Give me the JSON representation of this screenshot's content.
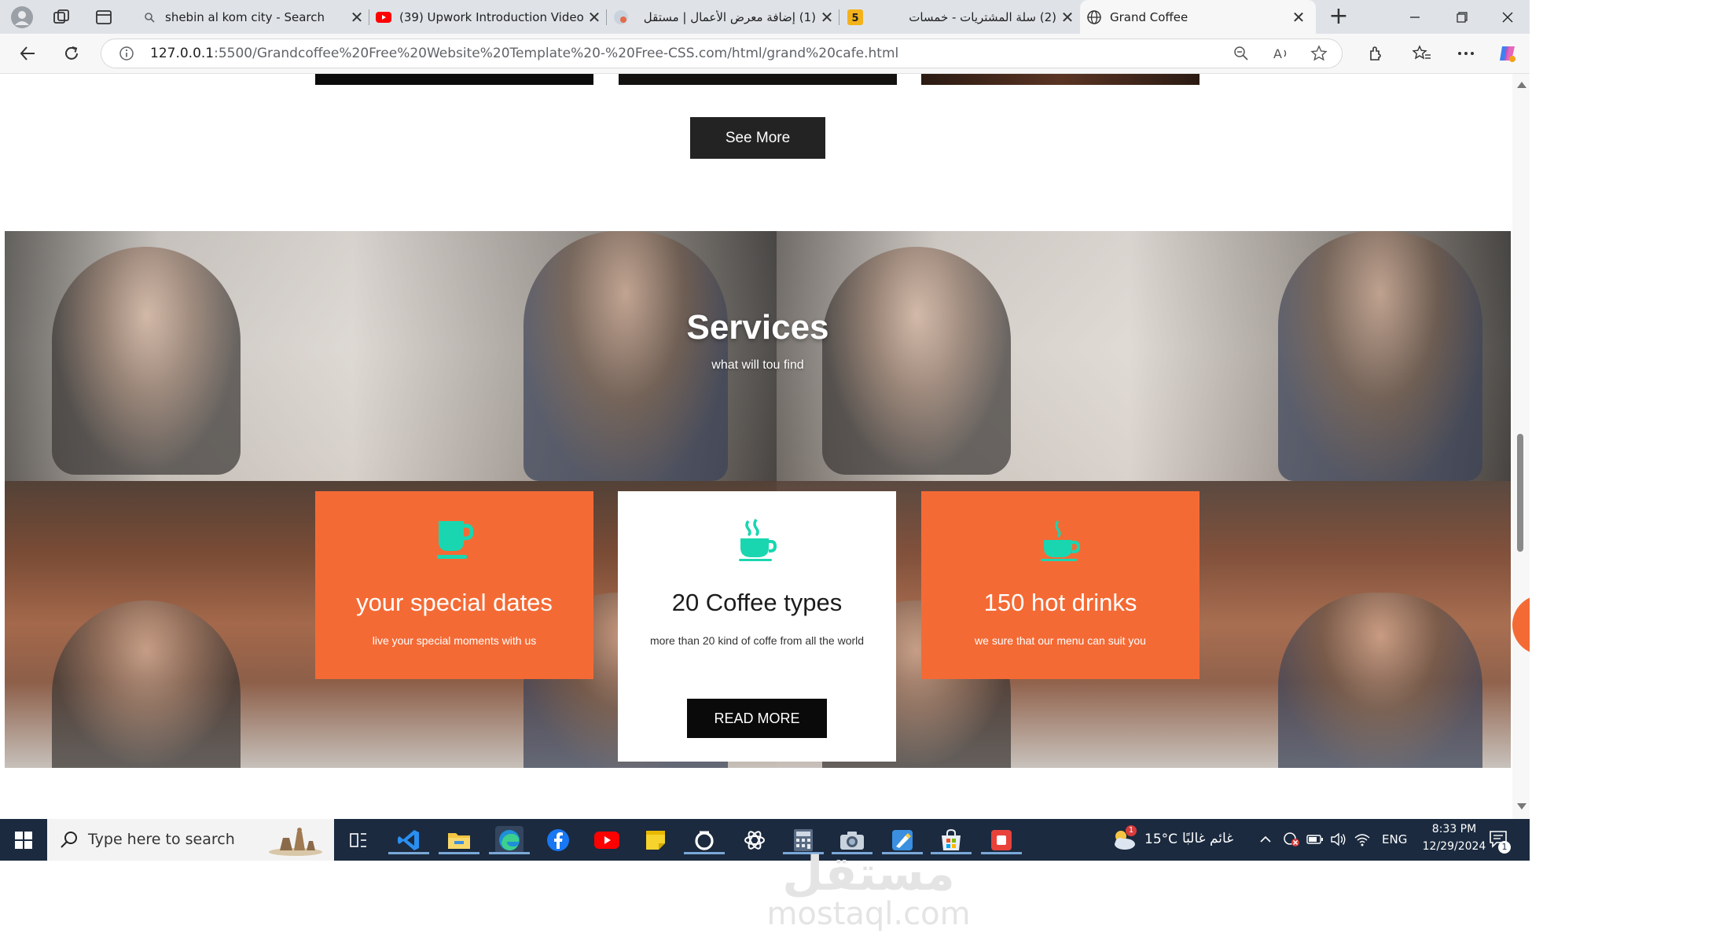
{
  "browser": {
    "tabs": [
      {
        "title": "shebin al kom city - Search",
        "favicon": "search-icon"
      },
      {
        "title": "(39) Upwork Introduction Video -",
        "favicon": "youtube-icon"
      },
      {
        "title": "(1) إضافة معرض الأعمال | مستقل",
        "favicon": "mostaql-icon"
      },
      {
        "title": "(2) سلة المشتريات - خمسات",
        "favicon": "khamsat-icon"
      },
      {
        "title": "Grand Coffee",
        "favicon": "globe-icon",
        "active": true
      }
    ],
    "new_tab_label": "+",
    "close_label": "✕",
    "url_host": "127.0.0.1",
    "url_rest": ":5500/Grandcoffee%20Free%20Website%20Template%20-%20Free-CSS.com/html/grand%20cafe.html"
  },
  "page": {
    "see_more_label": "See More",
    "services": {
      "title": "Services",
      "subtitle": "what will tou find",
      "cards": [
        {
          "title": "your special dates",
          "text": "live your special moments with us"
        },
        {
          "title": "20 Coffee types",
          "text": "more than 20 kind of coffe from all the world",
          "button": "READ MORE"
        },
        {
          "title": "150 hot drinks",
          "text": "we sure that our menu can suit you"
        }
      ]
    }
  },
  "taskbar": {
    "search_placeholder": "Type here to search",
    "weather_temp": "15°C",
    "weather_text": "غائم غالبًا",
    "language": "ENG",
    "time": "8:33 PM",
    "date": "12/29/2024",
    "notification_count": "1",
    "weather_badge": "1"
  },
  "watermark": {
    "logo": "مستقل",
    "url": "mostaql.com"
  },
  "colors": {
    "accent_orange": "#f46a35",
    "icon_teal": "#1ad6b0",
    "dark_button": "#232323",
    "taskbar": "#1b2a3f"
  }
}
